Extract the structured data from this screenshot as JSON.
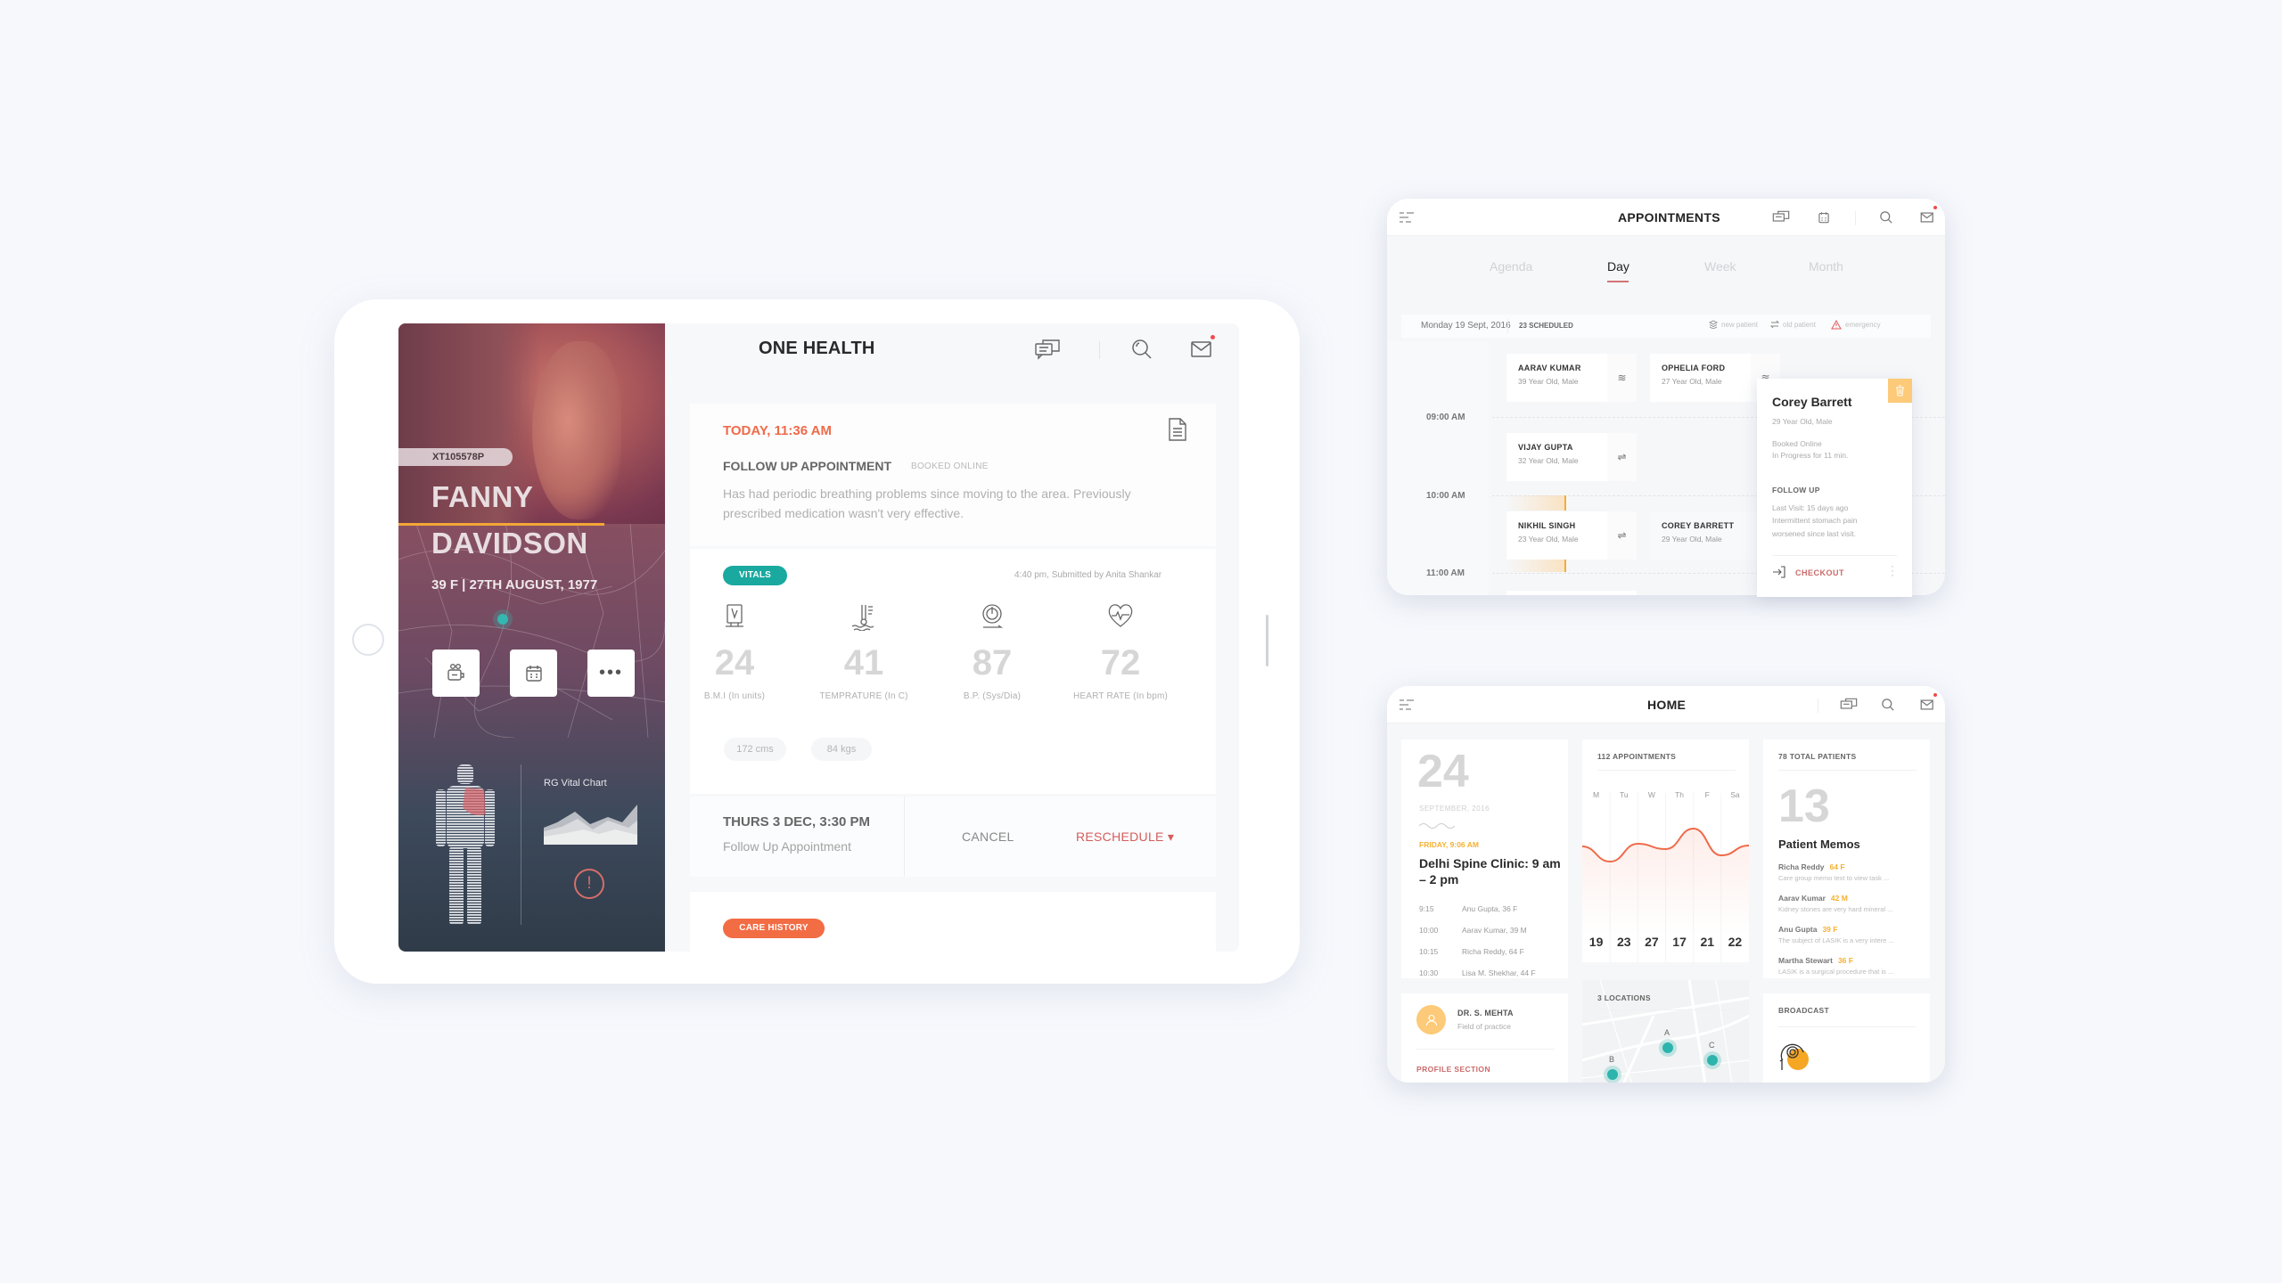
{
  "main_app": {
    "title": "ONE HEALTH",
    "header_icons": [
      "chat-icon",
      "search-icon",
      "mail-icon"
    ],
    "patient": {
      "id": "XT105578P",
      "first_name": "FANNY",
      "last_name": "DAVIDSON",
      "meta": "39 F  |  27TH AUGUST, 1977",
      "actions": [
        "video-call-icon",
        "calendar-icon",
        "more-icon"
      ],
      "vital_chart_label": "RG Vital Chart"
    },
    "appointment": {
      "time": "TODAY, 11:36 AM",
      "type": "FOLLOW UP APPOINTMENT",
      "booking": "BOOKED ONLINE",
      "description": "Has had periodic breathing problems since moving to the area. Previously prescribed medication wasn't very effective."
    },
    "vitals": {
      "badge": "VITALS",
      "submitted": "4:40 pm, Submitted by Anita Shankar",
      "items": [
        {
          "value": "24",
          "label": "B.M.I (In units)",
          "icon": "bmi-scale-icon"
        },
        {
          "value": "41",
          "label": "TEMPRATURE (In C)",
          "icon": "thermometer-icon"
        },
        {
          "value": "87",
          "label": "B.P. (Sys/Dia)",
          "icon": "blood-pressure-icon"
        },
        {
          "value": "72",
          "label": "HEART RATE (In bpm)",
          "icon": "heart-rate-icon"
        }
      ],
      "height": "172 cms",
      "weight": "84 kgs"
    },
    "next_appointment": {
      "date": "THURS 3 DEC, 3:30 PM",
      "type": "Follow Up Appointment",
      "cancel_label": "CANCEL",
      "reschedule_label": "RESCHEDULE ▾"
    },
    "care_history_badge": "CARE HISTORY"
  },
  "appointments_app": {
    "title": "APPOINTMENTS",
    "tabs": [
      {
        "label": "Agenda",
        "active": false
      },
      {
        "label": "Day",
        "active": true
      },
      {
        "label": "Week",
        "active": false
      },
      {
        "label": "Month",
        "active": false
      }
    ],
    "date": "Monday 19 Sept, 2016",
    "scheduled": "23 SCHEDULED",
    "legend": [
      "new patient",
      "old patient",
      "emergency"
    ],
    "times": [
      "09:00 AM",
      "10:00 AM",
      "11:00 AM"
    ],
    "patients": [
      {
        "name": "AARAV KUMAR",
        "sub": "39 Year Old, Male",
        "kind": "new"
      },
      {
        "name": "OPHELIA FORD",
        "sub": "27 Year Old, Male",
        "kind": "new"
      },
      {
        "name": "VIJAY GUPTA",
        "sub": "32 Year Old, Male",
        "kind": "old"
      },
      {
        "name": "NIKHIL SINGH",
        "sub": "23 Year Old, Male",
        "kind": "old"
      },
      {
        "name": "COREY BARRETT",
        "sub": "29 Year Old, Male",
        "kind": "selected"
      }
    ],
    "popup": {
      "name": "Corey Barrett",
      "sub": "29 Year Old, Male",
      "booking": "Booked Online",
      "status": "In Progress for 11 min.",
      "section": "FOLLOW UP",
      "last_visit": "Last Visit: 15 days ago",
      "note_1": "Intermittent stomach pain",
      "note_2": "worsened since last visit.",
      "checkout_label": "CHECKOUT"
    }
  },
  "home_app": {
    "title": "HOME",
    "date_card": {
      "day": "24",
      "month_year": "SEPTEMBER, 2016",
      "now": "FRIDAY, 9:06 AM",
      "clinic": "Delhi Spine Clinic: 9 am – 2 pm",
      "schedule": [
        {
          "time": "9:15",
          "patient": "Anu Gupta, 36 F"
        },
        {
          "time": "10:00",
          "patient": "Aarav Kumar, 39 M"
        },
        {
          "time": "10:15",
          "patient": "Richa Reddy, 64 F"
        },
        {
          "time": "10:30",
          "patient": "Lisa M. Shekhar, 44 F"
        }
      ]
    },
    "appointments_card": {
      "label": "112 APPOINTMENTS"
    },
    "patients_card": {
      "label": "78 TOTAL PATIENTS",
      "count": "13",
      "title": "Patient Memos",
      "memos": [
        {
          "name": "Richa Reddy",
          "meta": "64 F",
          "text": "Care group memo text to view task ..."
        },
        {
          "name": "Aarav Kumar",
          "meta": "42 M",
          "text": "Kidney stones are very hard mineral ..."
        },
        {
          "name": "Anu Gupta",
          "meta": "39 F",
          "text": "The subject of LASIK is a very intere ..."
        },
        {
          "name": "Martha Stewart",
          "meta": "36 F",
          "text": "LASIK is a surgical procedure that is ..."
        }
      ]
    },
    "doctor_card": {
      "name": "DR. S. MEHTA",
      "field": "Field of practice",
      "link": "PROFILE SECTION"
    },
    "locations_card": {
      "label": "3 LOCATIONS",
      "pins": [
        "A",
        "B",
        "C"
      ]
    },
    "broadcast_card": {
      "label": "BROADCAST"
    }
  },
  "chart_data": {
    "type": "line",
    "title": "112 APPOINTMENTS",
    "categories": [
      "M",
      "Tu",
      "W",
      "Th",
      "F",
      "Sa"
    ],
    "values": [
      19,
      23,
      27,
      17,
      21,
      22
    ],
    "trend_curve": [
      0.55,
      0.38,
      0.58,
      0.52,
      0.75,
      0.45,
      0.56
    ],
    "xlabel": "",
    "ylabel": "",
    "color": "#ef6a4a"
  },
  "colors": {
    "accent_orange": "#ef6a4a",
    "teal": "#1aa99f",
    "amber": "#f5b133",
    "reschedule_red": "#d45d5d"
  }
}
